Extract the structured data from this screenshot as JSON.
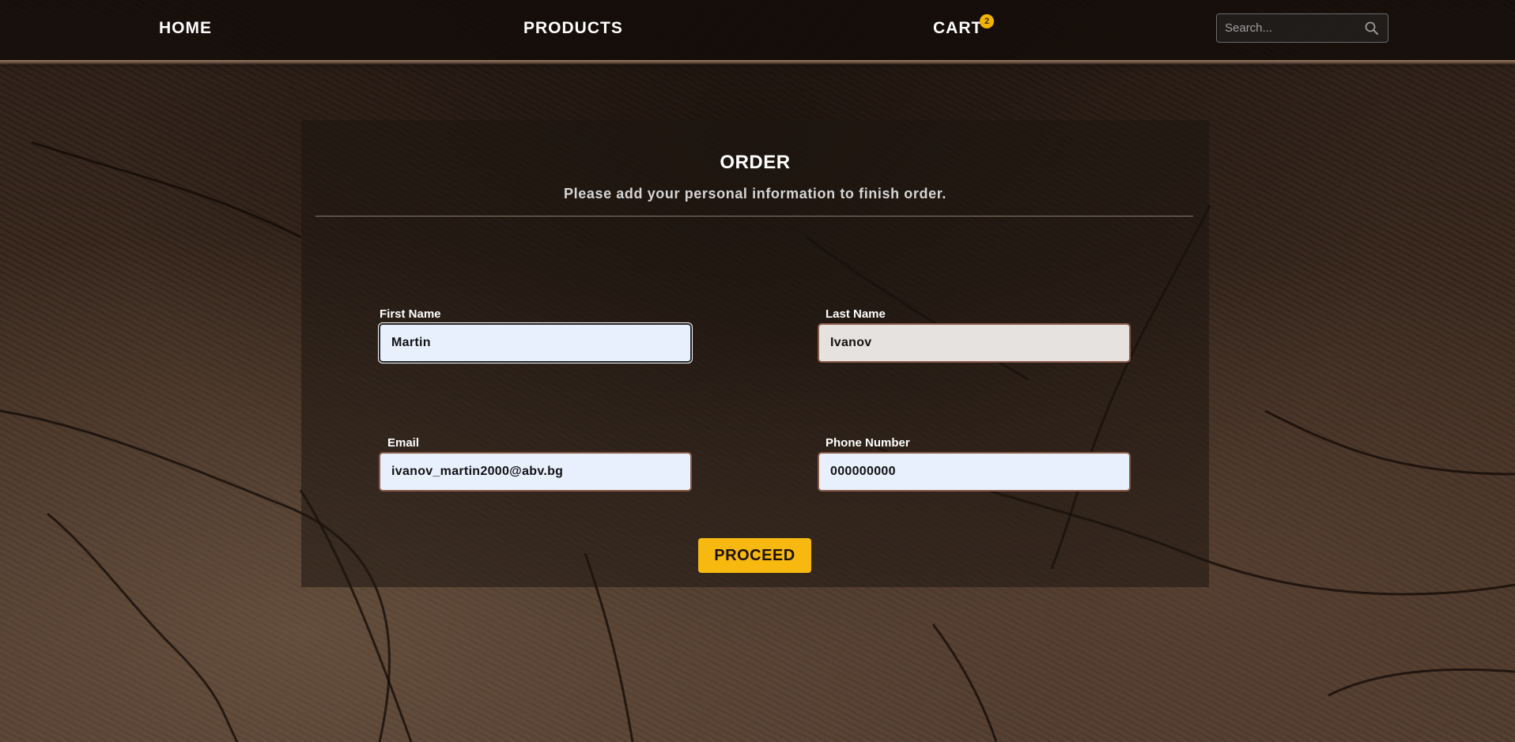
{
  "nav": {
    "home_label": "HOME",
    "products_label": "PRODUCTS",
    "cart_label": "CART",
    "cart_count": "2"
  },
  "search": {
    "placeholder": "Search...",
    "icon": "search-icon"
  },
  "order": {
    "title": "ORDER",
    "subtitle": "Please add your personal information to finish order.",
    "fields": {
      "first_name": {
        "label": "First Name",
        "value": "Martin"
      },
      "last_name": {
        "label": "Last Name",
        "value": "Ivanov"
      },
      "email": {
        "label": "Email",
        "value": "ivanov_martin2000@abv.bg"
      },
      "phone": {
        "label": "Phone Number",
        "value": "000000000"
      }
    },
    "proceed_label": "PROCEED"
  },
  "colors": {
    "accent": "#f7b80f",
    "badge": "#f2b400",
    "input_background": "#e8f0fe",
    "input_border": "#8a5a48"
  }
}
